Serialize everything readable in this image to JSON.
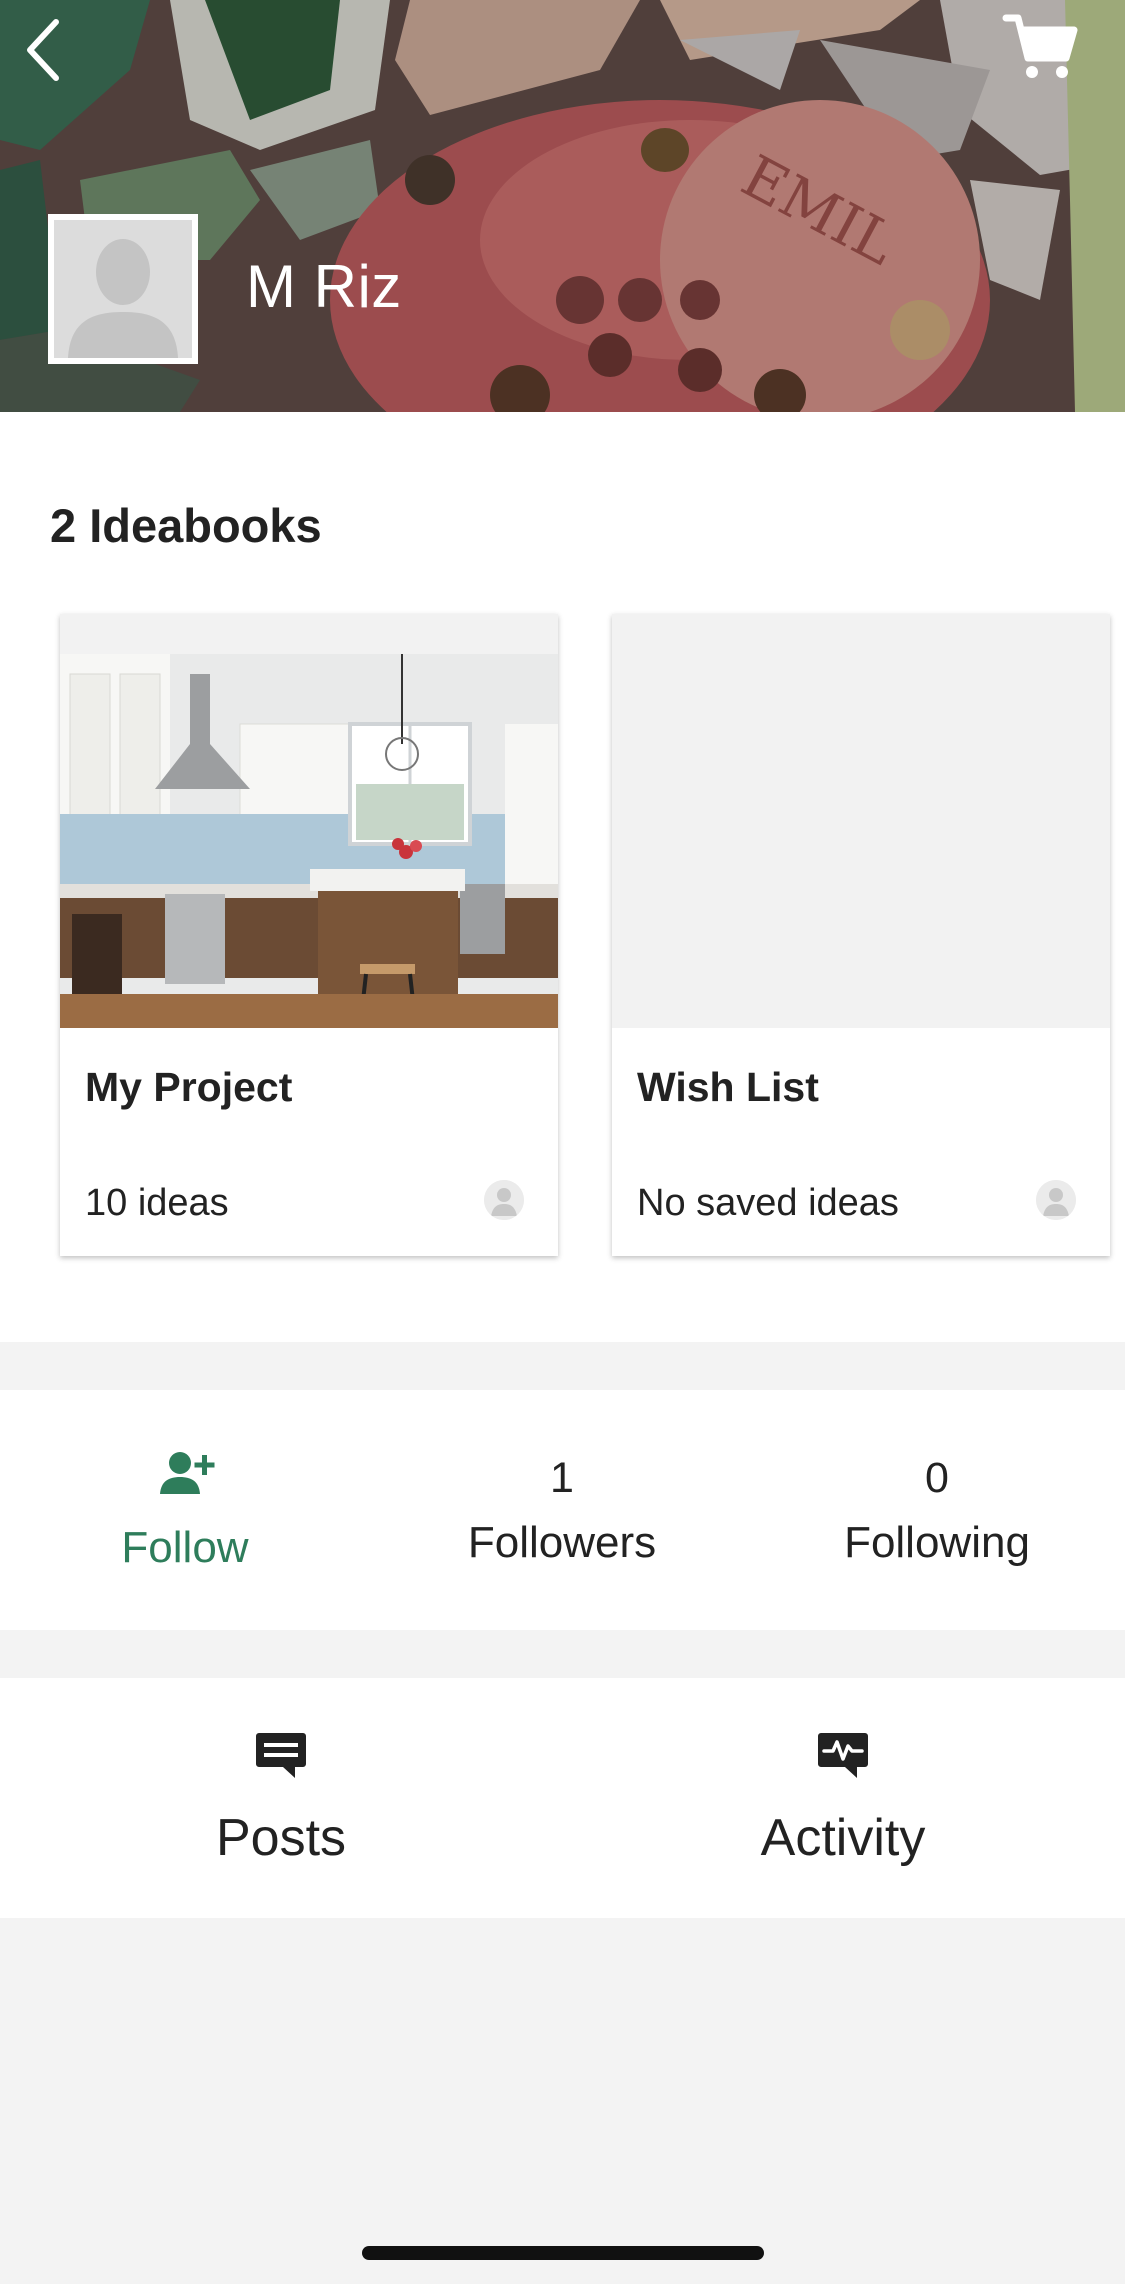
{
  "header": {
    "back_icon": "chevron-left-icon",
    "cart_icon": "shopping-cart-icon",
    "profile_name": "M Riz",
    "avatar_icon": "default-avatar-silhouette"
  },
  "ideabooks": {
    "title": "2 Ideabooks",
    "cards": [
      {
        "title": "My Project",
        "count": "10 ideas",
        "image": "kitchen-photo"
      },
      {
        "title": "Wish List",
        "count": "No saved ideas",
        "image": "empty"
      }
    ]
  },
  "stats": {
    "follow_label": "Follow",
    "followers_count": "1",
    "followers_label": "Followers",
    "following_count": "0",
    "following_label": "Following"
  },
  "tabs": {
    "posts_label": "Posts",
    "activity_label": "Activity"
  },
  "colors": {
    "accent_green": "#2e7d5b",
    "background": "#f3f3f3",
    "card_empty": "#f2f2f2"
  }
}
